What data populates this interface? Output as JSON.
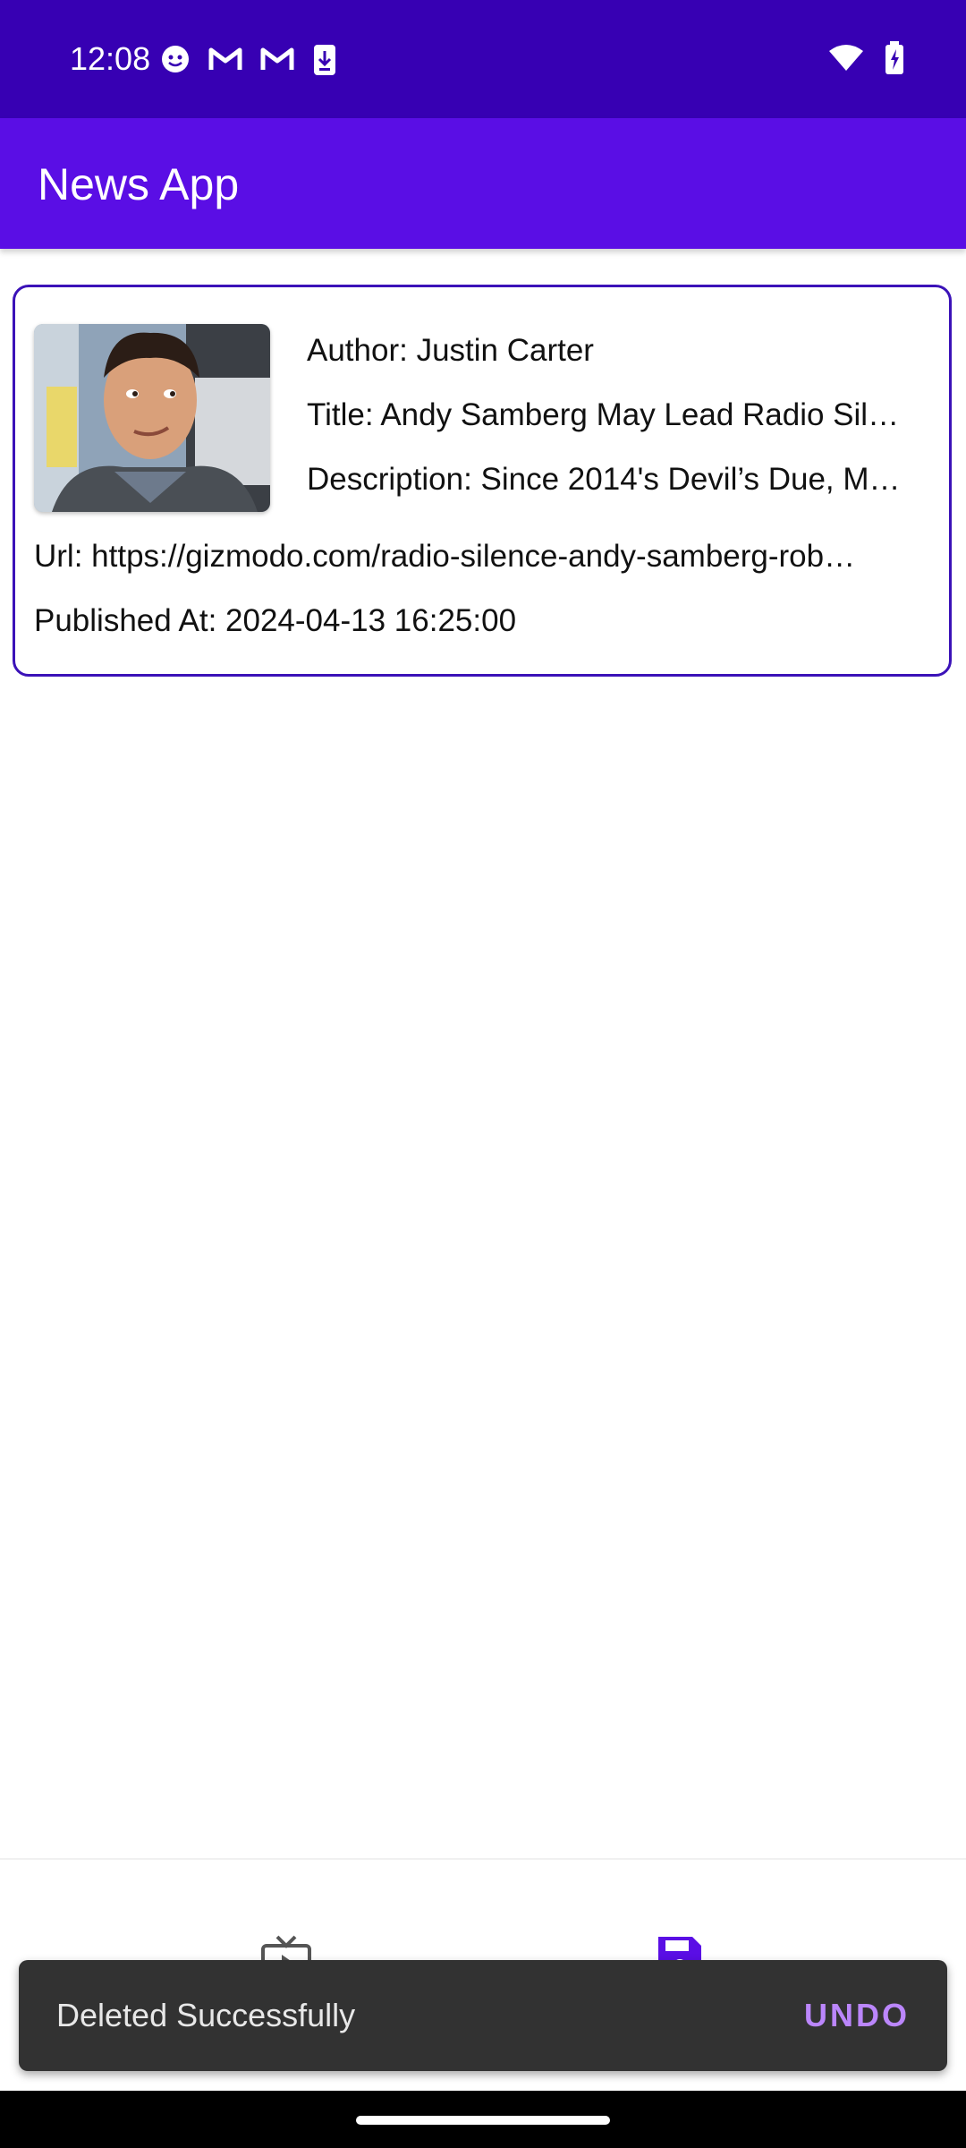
{
  "status_bar": {
    "time": "12:08",
    "icons": [
      "face-icon",
      "gmail-icon",
      "gmail-icon",
      "download-icon",
      "wifi-icon",
      "battery-charging-icon"
    ]
  },
  "app_bar": {
    "title": "News App",
    "color": "#5a0ee5"
  },
  "article": {
    "author": "Author: Justin Carter",
    "title": "Title: Andy Samberg May Lead Radio Sil…",
    "description": "Description: Since 2014's Devil’s Due, M…",
    "url": "Url: https://gizmodo.com/radio-silence-andy-samberg-rob…",
    "published_at": "Published At: 2024-04-13 16:25:00"
  },
  "bottom_nav": {
    "items": [
      "tv-icon",
      "save-icon"
    ],
    "active_color": "#5a0ee5"
  },
  "snackbar": {
    "message": "Deleted Successfully",
    "action": "UNDO"
  }
}
